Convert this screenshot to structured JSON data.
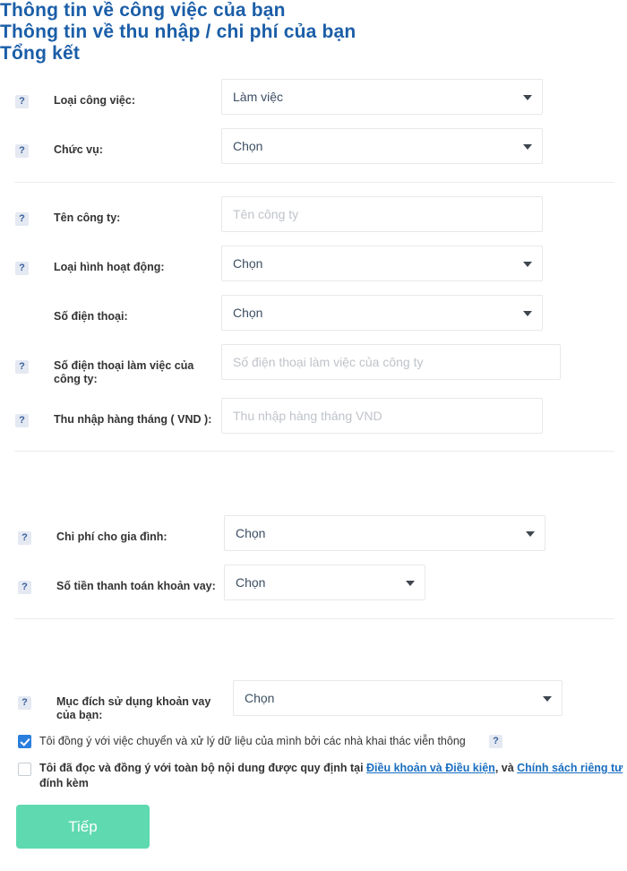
{
  "sections": [
    {
      "title": "Thông tin về công việc của bạn"
    },
    {
      "title": "Thông tin về thu nhập / chi phí của bạn"
    },
    {
      "title": "Tổng kết"
    }
  ],
  "help_glyph": "?",
  "fields": {
    "job_type": {
      "label": "Loại công việc:",
      "value": "Làm việc"
    },
    "position": {
      "label": "Chức vụ:",
      "value": "Chọn"
    },
    "company_name": {
      "label": "Tên công ty:",
      "placeholder": "Tên công ty"
    },
    "activity_type": {
      "label": "Loại hình hoạt động:",
      "value": "Chọn"
    },
    "phone": {
      "label": "Số điện thoại:",
      "value": "Chọn"
    },
    "company_phone": {
      "label": "Số điện thoại làm việc của công ty:",
      "placeholder": "Số điện thoại làm việc của công ty"
    },
    "monthly_income": {
      "label": "Thu nhập hàng tháng ( VND ):",
      "placeholder": "Thu nhập hàng tháng VND"
    },
    "family_expense": {
      "label": "Chi phí cho gia đình:",
      "value": "Chọn"
    },
    "loan_payment": {
      "label": "Số tiền thanh toán khoản vay:",
      "value": "Chọn"
    },
    "loan_purpose": {
      "label": "Mục đích sử dụng khoản vay của bạn:",
      "value": "Chọn"
    }
  },
  "consents": {
    "telecom": {
      "text": "Tôi đồng ý với việc chuyển và xử lý dữ liệu của mình bởi các nhà khai thác viễn thông",
      "checked": true
    },
    "terms": {
      "prefix": "Tôi đã đọc và đồng ý với toàn bộ nội dung được quy định tại ",
      "link1": "Điều khoản và Điều kiện",
      "middle": ", và ",
      "link2": "Chính sách riêng tư",
      "suffix": " đính kèm",
      "checked": false
    }
  },
  "submit": {
    "label": "Tiếp"
  },
  "colors": {
    "heading": "#1b5ea8",
    "link": "#1a6ec0",
    "submit_bg": "#5fd9b0",
    "checkbox_on": "#2a7ede",
    "help_bg": "#e4e9f2",
    "help_fg": "#3a5f9e",
    "field_border": "#e6e8eb",
    "placeholder": "#bfc3c9"
  }
}
